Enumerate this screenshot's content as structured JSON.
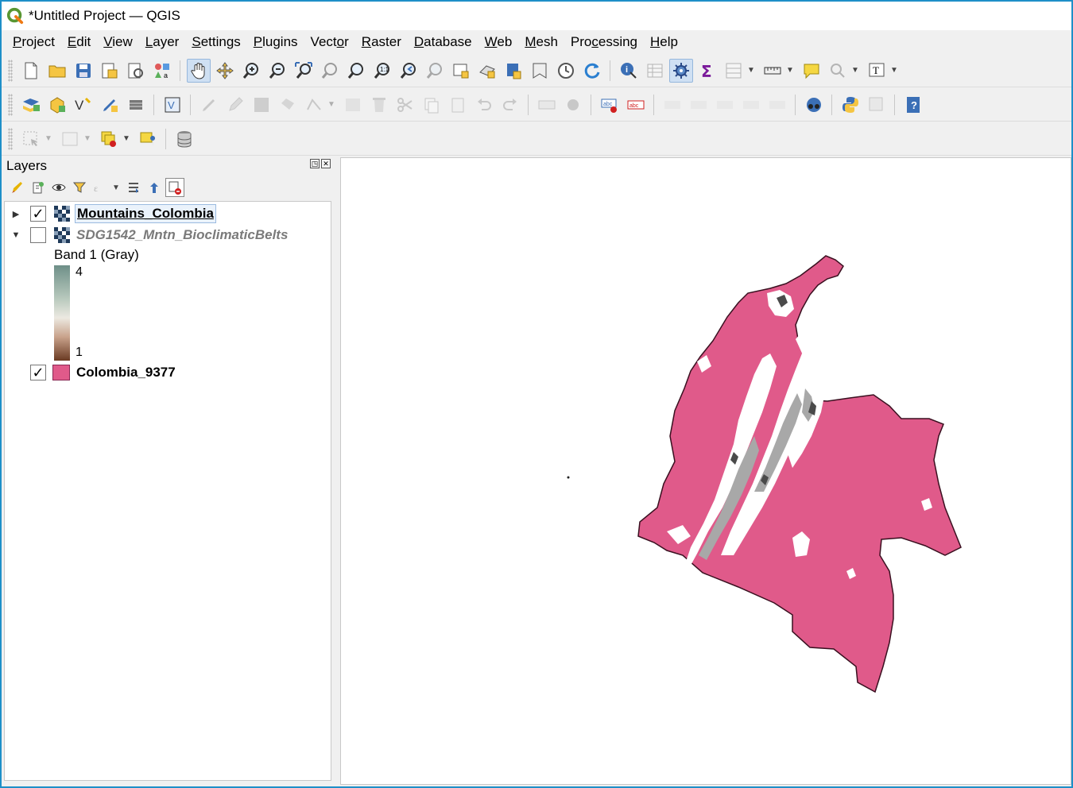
{
  "window": {
    "title": "*Untitled Project — QGIS"
  },
  "menu": [
    {
      "pre": "",
      "ul": "P",
      "post": "roject"
    },
    {
      "pre": "",
      "ul": "E",
      "post": "dit"
    },
    {
      "pre": "",
      "ul": "V",
      "post": "iew"
    },
    {
      "pre": "",
      "ul": "L",
      "post": "ayer"
    },
    {
      "pre": "",
      "ul": "S",
      "post": "ettings"
    },
    {
      "pre": "",
      "ul": "P",
      "post": "lugins"
    },
    {
      "pre": "Vect",
      "ul": "o",
      "post": "r"
    },
    {
      "pre": "",
      "ul": "R",
      "post": "aster"
    },
    {
      "pre": "",
      "ul": "D",
      "post": "atabase"
    },
    {
      "pre": "",
      "ul": "W",
      "post": "eb"
    },
    {
      "pre": "",
      "ul": "M",
      "post": "esh"
    },
    {
      "pre": "Pro",
      "ul": "c",
      "post": "essing"
    },
    {
      "pre": "",
      "ul": "H",
      "post": "elp"
    }
  ],
  "layers_panel": {
    "title": "Layers",
    "layers": [
      {
        "name": "Mountains_Colombia",
        "checked": "✓",
        "expander": "▶",
        "type": "raster"
      },
      {
        "name": "SDG1542_Mntn_BioclimaticBelts",
        "checked": "",
        "expander": "▼",
        "type": "raster"
      },
      {
        "name": "Colombia_9377",
        "checked": "✓",
        "expander": "",
        "type": "polygon"
      }
    ],
    "legend": {
      "band": "Band 1 (Gray)",
      "max": "4",
      "min": "1"
    }
  },
  "colors": {
    "colombia_fill": "#e05a8a",
    "colombia_stroke": "#3a1020",
    "mountain_light": "#ffffff",
    "mountain_mid": "#a8a8a8",
    "mountain_dark": "#4a4a4a",
    "accent": "#1e8fc8"
  }
}
